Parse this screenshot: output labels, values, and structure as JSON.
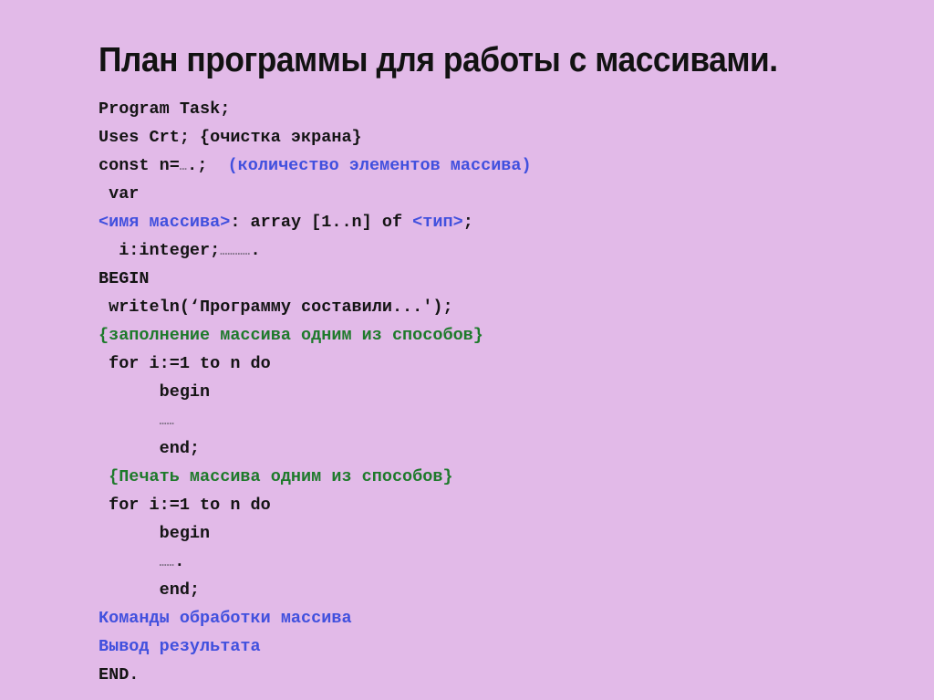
{
  "slide": {
    "title": "План программы для работы с массивами.",
    "background_color": "#e2bae8",
    "text_color": "#141414",
    "accent_blue": "#4150de",
    "accent_green": "#1e7a2b",
    "dots_color": "#7d6f84"
  },
  "code": {
    "language": "Pascal",
    "lines": [
      {
        "id": "line-program",
        "segments": [
          {
            "text": "Program Task;",
            "style": "plain"
          }
        ]
      },
      {
        "id": "line-uses",
        "segments": [
          {
            "text": "Uses Crt; {очистка экрана}",
            "style": "plain"
          }
        ]
      },
      {
        "id": "line-const",
        "segments": [
          {
            "text": "const n=",
            "style": "plain"
          },
          {
            "text": "…",
            "style": "dots"
          },
          {
            "text": ".;  ",
            "style": "plain"
          },
          {
            "text": "(количество элементов массива)",
            "style": "blue"
          }
        ]
      },
      {
        "id": "line-var",
        "segments": [
          {
            "text": " var",
            "style": "plain"
          }
        ]
      },
      {
        "id": "line-array-decl",
        "segments": [
          {
            "text": "<имя массива>",
            "style": "blue"
          },
          {
            "text": ": array [1..n] of ",
            "style": "plain"
          },
          {
            "text": "<тип>",
            "style": "blue"
          },
          {
            "text": ";",
            "style": "plain"
          }
        ]
      },
      {
        "id": "line-i-integer",
        "segments": [
          {
            "text": "  i:integer;",
            "style": "plain"
          },
          {
            "text": "…………",
            "style": "dots"
          },
          {
            "text": ".",
            "style": "plain"
          }
        ]
      },
      {
        "id": "line-begin-main",
        "segments": [
          {
            "text": "BEGIN",
            "style": "plain"
          }
        ]
      },
      {
        "id": "line-writeln",
        "segments": [
          {
            "text": " writeln(‘Программу составили...');",
            "style": "plain"
          }
        ]
      },
      {
        "id": "line-comment-fill",
        "segments": [
          {
            "text": "{заполнение массива одним из способов}",
            "style": "green"
          }
        ]
      },
      {
        "id": "line-for-fill",
        "segments": [
          {
            "text": " for i:=1 to n do",
            "style": "plain"
          }
        ]
      },
      {
        "id": "line-begin-fill",
        "segments": [
          {
            "text": "      begin",
            "style": "plain"
          }
        ]
      },
      {
        "id": "line-dots-fill",
        "segments": [
          {
            "text": "      ",
            "style": "plain"
          },
          {
            "text": "……",
            "style": "dots"
          }
        ]
      },
      {
        "id": "line-end-fill",
        "segments": [
          {
            "text": "      end;",
            "style": "plain"
          }
        ]
      },
      {
        "id": "line-comment-print",
        "segments": [
          {
            "text": " {Печать массива одним из способов}",
            "style": "green"
          }
        ]
      },
      {
        "id": "line-for-print",
        "segments": [
          {
            "text": " for i:=1 to n do",
            "style": "plain"
          }
        ]
      },
      {
        "id": "line-begin-print",
        "segments": [
          {
            "text": "      begin",
            "style": "plain"
          }
        ]
      },
      {
        "id": "line-dots-print",
        "segments": [
          {
            "text": "      ",
            "style": "plain"
          },
          {
            "text": "……",
            "style": "dots"
          },
          {
            "text": ".",
            "style": "plain"
          }
        ]
      },
      {
        "id": "line-end-print",
        "segments": [
          {
            "text": "      end;",
            "style": "plain"
          }
        ]
      },
      {
        "id": "line-commands",
        "segments": [
          {
            "text": "Команды обработки массива",
            "style": "blue"
          }
        ]
      },
      {
        "id": "line-output",
        "segments": [
          {
            "text": "Вывод результата",
            "style": "blue"
          }
        ]
      },
      {
        "id": "line-end-program",
        "segments": [
          {
            "text": "END.",
            "style": "plain"
          }
        ]
      }
    ]
  }
}
